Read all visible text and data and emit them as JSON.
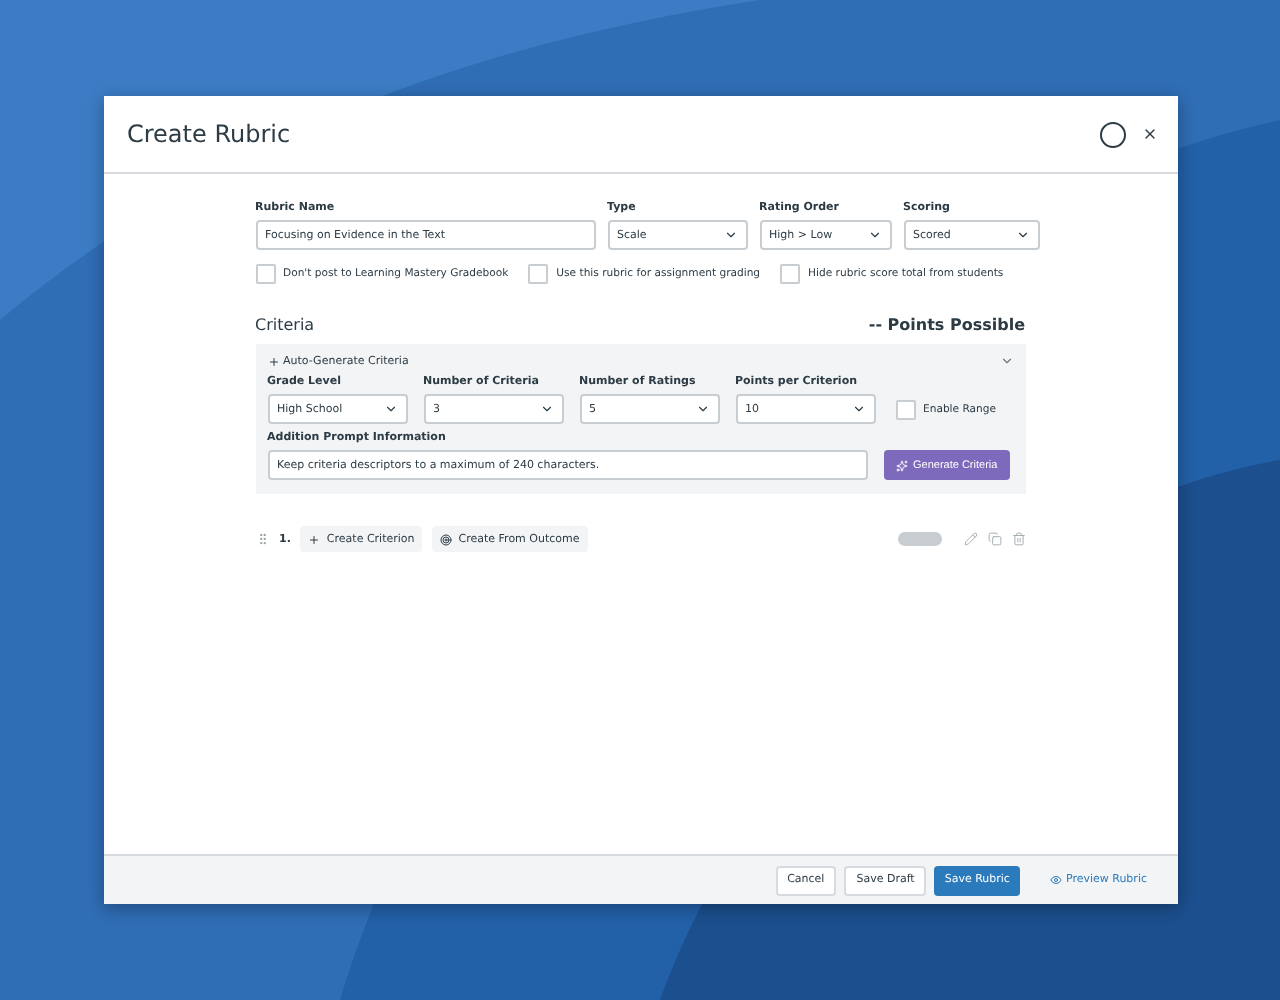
{
  "dialog": {
    "title": "Create Rubric"
  },
  "fields": [
    {
      "label": "Rubric Name",
      "kind": "text",
      "value": "Focusing on Evidence in the Text"
    },
    {
      "label": "Type",
      "kind": "select",
      "value": "Scale"
    },
    {
      "label": "Rating Order",
      "kind": "select",
      "value": "High > Low"
    },
    {
      "label": "Scoring",
      "kind": "select",
      "value": "Scored"
    }
  ],
  "options": [
    {
      "label": "Don't post to Learning Mastery Gradebook",
      "checked": false
    },
    {
      "label": "Use this rubric for assignment grading",
      "checked": false
    },
    {
      "label": "Hide rubric score total from students",
      "checked": false
    }
  ],
  "criteria": {
    "heading": "Criteria",
    "points": "-- Points Possible"
  },
  "auto_generate": {
    "title": "Auto-Generate Criteria",
    "expanded": true,
    "selects": [
      {
        "label": "Grade Level",
        "value": "High School"
      },
      {
        "label": "Number of Criteria",
        "value": "3"
      },
      {
        "label": "Number of Ratings",
        "value": "5"
      },
      {
        "label": "Points per Criterion",
        "value": "10"
      }
    ],
    "enable_range": {
      "label": "Enable Range",
      "checked": false
    },
    "prompt_label": "Addition Prompt Information",
    "prompt_value": "Keep criteria descriptors to a maximum of 240 characters.",
    "generate_button": "Generate Criteria"
  },
  "criterion_row": {
    "number": "1.",
    "create_button": "Create Criterion",
    "outcome_button": "Create From Outcome"
  },
  "footer": {
    "buttons": [
      {
        "label": "Cancel",
        "kind": "secondary"
      },
      {
        "label": "Save Draft",
        "kind": "secondary"
      },
      {
        "label": "Save Rubric",
        "kind": "primary"
      },
      {
        "label": "Preview Rubric",
        "kind": "link"
      }
    ]
  }
}
